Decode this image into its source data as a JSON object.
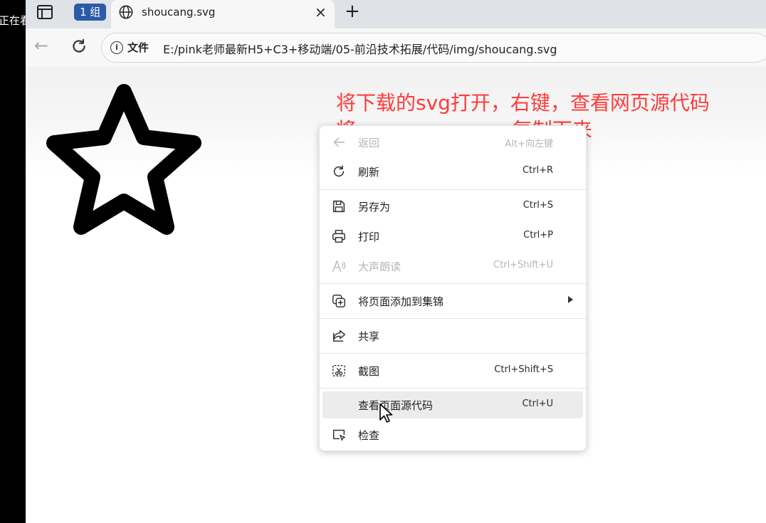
{
  "left_strip": {
    "text": "正在看"
  },
  "tabbar": {
    "group_label": "1 组",
    "tab_title": "shoucang.svg",
    "close_glyph": "×",
    "new_tab_glyph": "+"
  },
  "navbar": {
    "back_glyph": "←",
    "info_glyph": "i",
    "file_label": "文件",
    "url": "E:/pink老师最新H5+C3+移动端/05-前沿技术拓展/代码/img/shoucang.svg"
  },
  "annotation": {
    "line1": "将下载的svg打开，右键，查看网页源代码",
    "line2": "将<svg>　<svg>复制下来"
  },
  "context_menu": {
    "items": [
      {
        "label": "返回",
        "shortcut": "Alt+向左键",
        "icon": "back-arrow-icon",
        "disabled": true
      },
      {
        "label": "刷新",
        "shortcut": "Ctrl+R",
        "icon": "refresh-icon",
        "disabled": false
      },
      {
        "label": "另存为",
        "shortcut": "Ctrl+S",
        "icon": "save-icon",
        "disabled": false
      },
      {
        "label": "打印",
        "shortcut": "Ctrl+P",
        "icon": "printer-icon",
        "disabled": false
      },
      {
        "label": "大声朗读",
        "shortcut": "Ctrl+Shift+U",
        "icon": "read-aloud-icon",
        "disabled": true
      },
      {
        "label": "将页面添加到集锦",
        "shortcut": "",
        "icon": "collections-add-icon",
        "disabled": false
      },
      {
        "label": "共享",
        "shortcut": "",
        "icon": "share-icon",
        "disabled": false
      },
      {
        "label": "截图",
        "shortcut": "Ctrl+Shift+S",
        "icon": "screenshot-icon",
        "disabled": false
      },
      {
        "label": "查看页面源代码",
        "shortcut": "Ctrl+U",
        "icon": "",
        "disabled": false,
        "highlighted": true
      },
      {
        "label": "检查",
        "shortcut": "",
        "icon": "inspect-icon",
        "disabled": false
      }
    ]
  },
  "colors": {
    "annotation": "#ff3b3b",
    "group_chip": "#2b5aa8"
  }
}
